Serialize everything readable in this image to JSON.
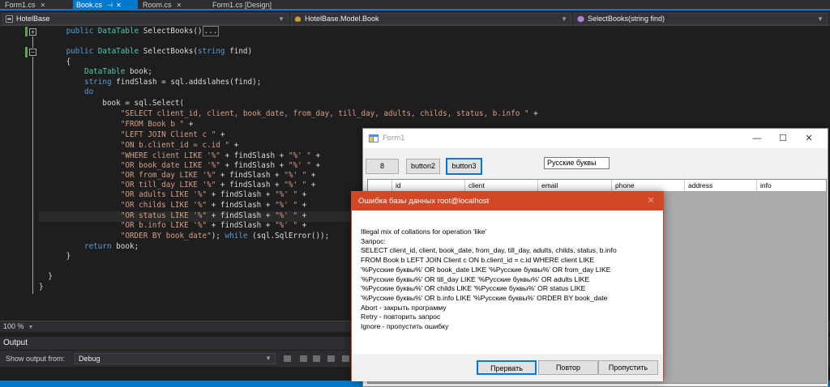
{
  "tabs": [
    {
      "label": "Form1.cs",
      "active": false
    },
    {
      "label": "Book.cs",
      "active": true
    },
    {
      "label": "Room.cs",
      "active": false
    },
    {
      "label": "Form1.cs [Design]",
      "active": false
    }
  ],
  "navbar": {
    "project": "HotelBase",
    "class": "HotelBase.Model.Book",
    "member": "SelectBooks(string find)"
  },
  "editor": {
    "zoom": "100 %"
  },
  "output": {
    "title": "Output",
    "show_from_label": "Show output from:",
    "show_from_value": "Debug"
  },
  "form1": {
    "title": "Form1",
    "buttons": [
      "8",
      "button2",
      "button3"
    ],
    "textbox_value": "Русские буквы",
    "columns": [
      "id",
      "client",
      "email",
      "phone",
      "address",
      "info"
    ]
  },
  "dialog": {
    "title": "Ошибка базы данных root@localhost",
    "lines": [
      "Illegal mix of collations for operation 'like'",
      "Запрос:",
      "SELECT client_id, client, book_date, from_day, till_day, adults, childs, status, b.info",
      "FROM Book b LEFT JOIN Client c ON b.client_id = c.id WHERE client LIKE",
      "'%Русские буквы%' OR book_date LIKE '%Русские буквы%' OR from_day LIKE",
      "'%Русские буквы%' OR till_day LIKE '%Русские буквы%' OR adults LIKE",
      "'%Русские буквы%' OR childs LIKE '%Русские буквы%' OR status LIKE",
      "'%Русские буквы%' OR b.info LIKE '%Русские буквы%' ORDER BY book_date",
      "Abort - закрыть программу",
      "Retry - повторить запрос",
      "Ignore - пропустить ошибку"
    ],
    "buttons": {
      "abort": "Прервать",
      "retry": "Повтор",
      "ignore": "Пропустить"
    }
  }
}
